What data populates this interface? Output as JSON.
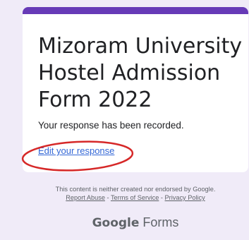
{
  "form": {
    "title": "Mizoram University Hostel Admission Form 2022",
    "confirmation_message": "Your response has been recorded.",
    "edit_link_label": "Edit your response"
  },
  "footer": {
    "disclaimer": "This content is neither created nor endorsed by Google.",
    "links": {
      "report_abuse": "Report Abuse",
      "terms_of_service": "Terms of Service",
      "privacy_policy": "Privacy Policy",
      "separator": " - "
    },
    "brand": {
      "google": "Google",
      "product": "Forms"
    }
  },
  "colors": {
    "page_background": "#f0ebf8",
    "theme_accent": "#673ab7",
    "link": "#3367d6",
    "annotation_ellipse": "#d62828"
  }
}
